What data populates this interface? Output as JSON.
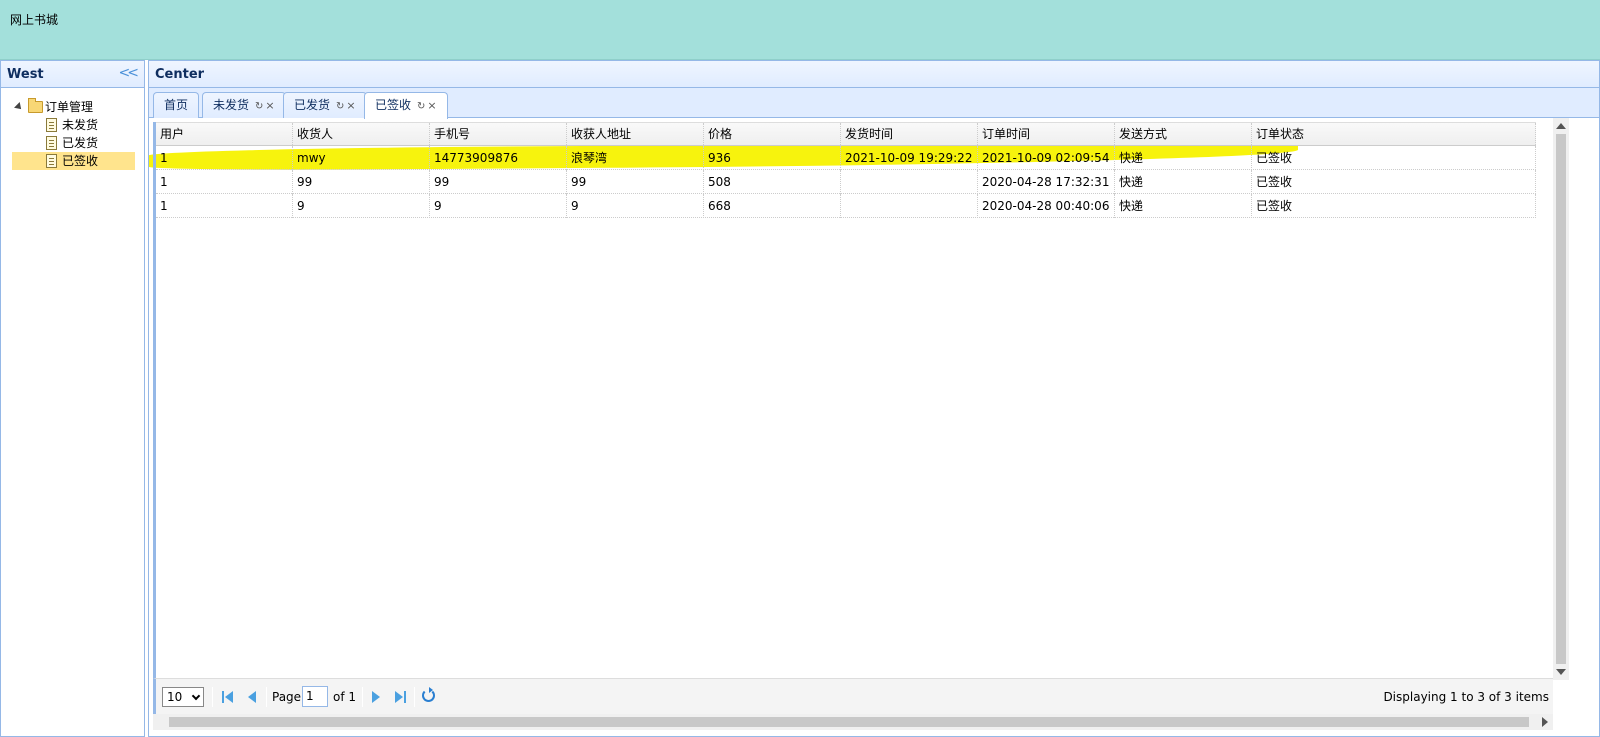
{
  "north": {
    "title": "网上书城"
  },
  "west": {
    "title": "West",
    "tree": {
      "root": "订单管理",
      "children": [
        "未发货",
        "已发货",
        "已签收"
      ]
    }
  },
  "center": {
    "title": "Center",
    "tabs": [
      {
        "label": "首页"
      },
      {
        "label": "未发货",
        "tool": "↻",
        "close": "×"
      },
      {
        "label": "已发货",
        "tool": "↻",
        "close": "×"
      },
      {
        "label": "已签收",
        "tool": "↻",
        "close": "×"
      }
    ],
    "grid": {
      "columns": [
        "用户",
        "收货人",
        "手机号",
        "收获人地址",
        "价格",
        "发货时间",
        "订单时间",
        "发送方式",
        "订单状态"
      ],
      "rows": [
        [
          "1",
          "mwy",
          "14773909876",
          "浪琴湾",
          "936",
          "2021-10-09 19:29:22",
          "2021-10-09 02:09:54",
          "快递",
          "已签收"
        ],
        [
          "1",
          "99",
          "99",
          "99",
          "508",
          "",
          "2020-04-28 17:32:31",
          "快递",
          "已签收"
        ],
        [
          "1",
          "9",
          "9",
          "9",
          "668",
          "",
          "2020-04-28 00:40:06",
          "快递",
          "已签收"
        ]
      ]
    },
    "pager": {
      "page_size": "10",
      "page_label": "Page",
      "page_value": "1",
      "of_label": "of 1",
      "info": "Displaying 1 to 3 of 3 items"
    }
  },
  "colors": {
    "banner": "#a3e0db",
    "highlight": "#f7f200",
    "border": "#95b8e7"
  }
}
